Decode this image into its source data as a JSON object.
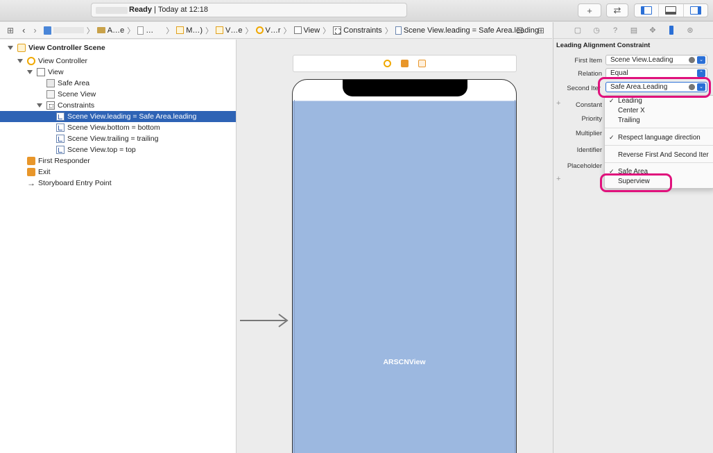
{
  "toolbar": {
    "status": "Ready",
    "time": "Today at 12:18",
    "add_icon": "plus-icon",
    "swap_icon": "assistant-arrows-icon",
    "panels": [
      "navigator-pane-icon",
      "debug-area-icon",
      "inspector-pane-icon"
    ]
  },
  "jumpbar": {
    "items": [
      "A…e",
      "…",
      "M…)",
      "V…e",
      "V…r",
      "View",
      "Constraints",
      "Scene View.leading = Safe Area.leading"
    ]
  },
  "outline": {
    "rows": [
      "View Controller Scene",
      "View Controller",
      "View",
      "Safe Area",
      "Scene View",
      "Constraints",
      "Scene View.leading = Safe Area.leading",
      "Scene View.bottom = bottom",
      "Scene View.trailing = trailing",
      "Scene View.top = top",
      "First Responder",
      "Exit",
      "Storyboard Entry Point"
    ]
  },
  "canvas": {
    "view_label": "ARSCNView"
  },
  "inspector": {
    "title": "Leading Alignment Constraint",
    "labels": {
      "first_item": "First Item",
      "relation": "Relation",
      "second_item": "Second Iter",
      "constant": "Constant",
      "priority": "Priority",
      "multiplier": "Multiplier",
      "identifier": "Identifier",
      "placeholder": "Placeholder"
    },
    "values": {
      "first_item": "Scene View.Leading",
      "relation": "Equal",
      "second_item": "Safe Area.Leading"
    }
  },
  "menu": {
    "items": [
      "Leading",
      "Center X",
      "Trailing",
      "Respect language direction",
      "Reverse First And Second Iter",
      "Safe Area",
      "Superview"
    ]
  },
  "colors": {
    "selection": "#2e63b5",
    "accent": "#2a6fd6",
    "highlight": "#e0117c",
    "arview": "#9cb8e0"
  }
}
